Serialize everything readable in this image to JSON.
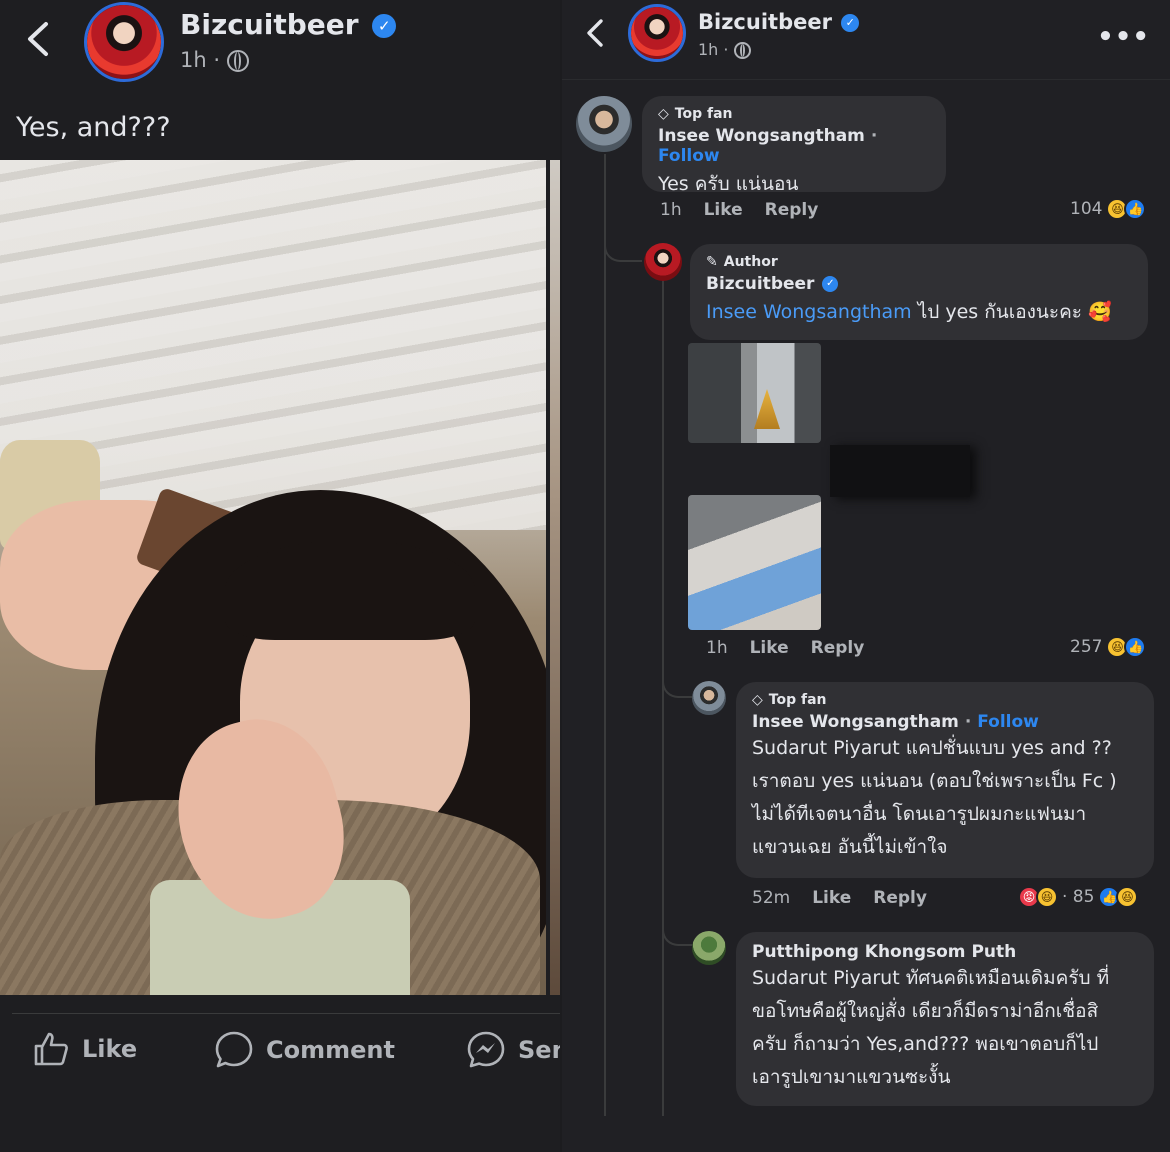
{
  "left": {
    "author": "Bizcuitbeer",
    "time": "1h",
    "dot": "·",
    "caption": "Yes, and???",
    "actions": {
      "like": "Like",
      "comment": "Comment",
      "send": "Sen"
    }
  },
  "right": {
    "author": "Bizcuitbeer",
    "time": "1h",
    "dot": "·",
    "more": "•••",
    "comments": [
      {
        "badge": "Top fan",
        "name": "Insee Wongsangtham",
        "follow": "Follow",
        "text": "Yes ครับ แน่นอน",
        "time": "1h",
        "like": "Like",
        "reply": "Reply",
        "count": "104"
      },
      {
        "badge": "Author",
        "name": "Bizcuitbeer",
        "mention": "Insee Wongsangtham",
        "text": " ไป yes กันเองนะคะ 🥰",
        "time": "1h",
        "like": "Like",
        "reply": "Reply",
        "count": "257"
      },
      {
        "badge": "Top fan",
        "name": "Insee Wongsangtham",
        "follow": "Follow",
        "lines": [
          "Sudarut Piyarut  แคปชั่นแบบ yes and ??",
          "เราตอบ yes แน่นอน (ตอบใช่เพราะเป็น Fc )",
          "ไม่ได้ทีเจตนาอื่น โดนเอารูปผมกะแฟนมา",
          "แขวนเฉย อันนี้ไม่เข้าใจ"
        ],
        "time": "52m",
        "like": "Like",
        "reply": "Reply",
        "count": "· 85"
      },
      {
        "name": "Putthipong Khongsom Puth",
        "lines": [
          "Sudarut Piyarut ทัศนคติเหมือนเดิมครับ ที่",
          "ขอโทษคือผู้ใหญ่สั่ง เดียวก็มีดราม่าอีกเชื่อสิ",
          "ครับ ก็ถามว่า Yes,and??? พอเขาตอบก็ไป",
          "เอารูปเขามาแขวนซะงั้น"
        ]
      }
    ]
  },
  "colors": {
    "accent": "#2d87f0",
    "background": "#1e1e21",
    "bubble": "#303034"
  }
}
